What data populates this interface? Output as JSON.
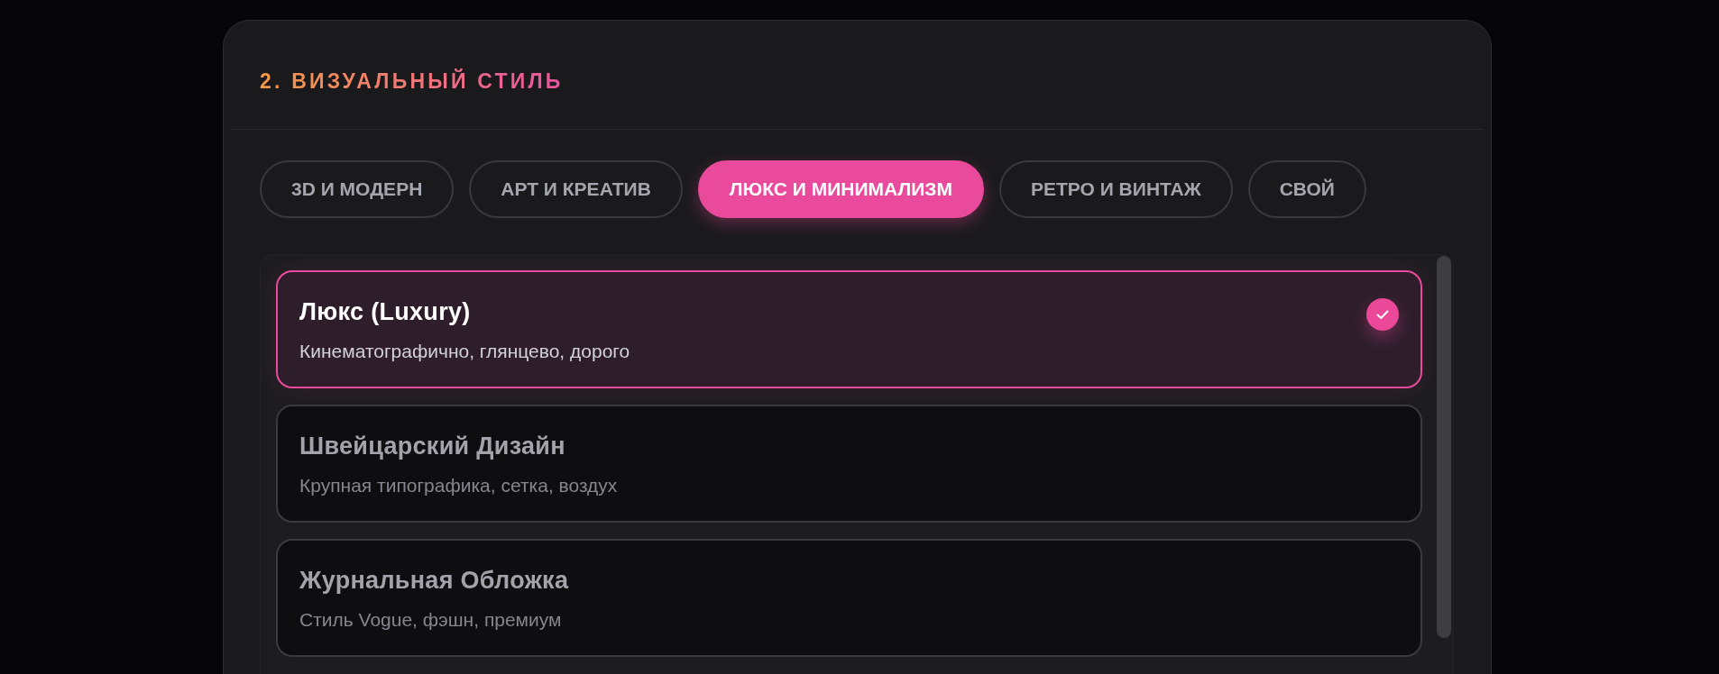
{
  "panel": {
    "title": "2. ВИЗУАЛЬНЫЙ СТИЛЬ"
  },
  "tabs": [
    {
      "label": "3D И МОДЕРН",
      "selected": false
    },
    {
      "label": "АРТ И КРЕАТИВ",
      "selected": false
    },
    {
      "label": "ЛЮКС И МИНИМАЛИЗМ",
      "selected": true
    },
    {
      "label": "РЕТРО И ВИНТАЖ",
      "selected": false
    },
    {
      "label": "СВОЙ",
      "selected": false
    }
  ],
  "styles": [
    {
      "title": "Люкс (Luxury)",
      "description": "Кинематографично, глянцево, дорого",
      "selected": true
    },
    {
      "title": "Швейцарский Дизайн",
      "description": "Крупная типографика, сетка, воздух",
      "selected": false
    },
    {
      "title": "Журнальная Обложка",
      "description": "Стиль Vogue, фэшн, премиум",
      "selected": false
    }
  ]
}
